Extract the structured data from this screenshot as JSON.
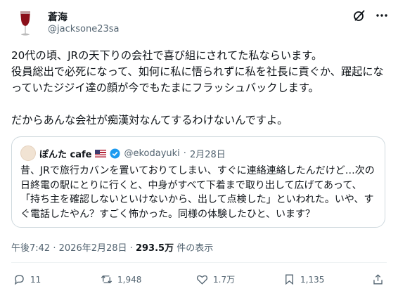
{
  "author": {
    "name": "蒼海",
    "handle": "@jacksone23sa",
    "avatar_icon": "wine-glass-icon"
  },
  "header_icons": [
    "grok-icon",
    "more-icon"
  ],
  "tweet_text": "20代の頃、JRの天下りの会社で喜び組にされてた私ならいます。\n役員総出で必死になって、如何に私に悟られずに私を社長に貢ぐか、躍起になっていたジジイ達の顔が今でもたまにフラッシュバックします。\n\nだからあんな会社が痴漢対なんてするわけないんですよ。",
  "quote": {
    "name": "ぽんた cafe",
    "flag_icon": "us-flag-icon",
    "verified_icon": "verified-badge-icon",
    "handle": "@ekodayuki",
    "dot": "·",
    "date": "2月28日",
    "text": "昔、JRで旅行カバンを置いておりてしまい、すぐに連絡連絡したんだけど…次の日終電の駅にとりに行くと、中身がすべて下着まで取り出して広げてあって、「持ち主を確認しないといけないから、出して点検した」といわれた。いや、すぐ電話したやん？すごく怖かった。同様の体験したひと、います？"
  },
  "meta": {
    "time": "午後7:42",
    "dot": "·",
    "date": "2026年2月28日",
    "views_count": "293.5万",
    "views_label": "件の表示"
  },
  "actions": {
    "replies": "11",
    "reposts": "1,948",
    "likes": "1.7万",
    "bookmarks": "1,135"
  },
  "colors": {
    "text": "#0f1419",
    "secondary": "#536471",
    "border": "#cfd9de",
    "verified": "#1d9bf0"
  }
}
